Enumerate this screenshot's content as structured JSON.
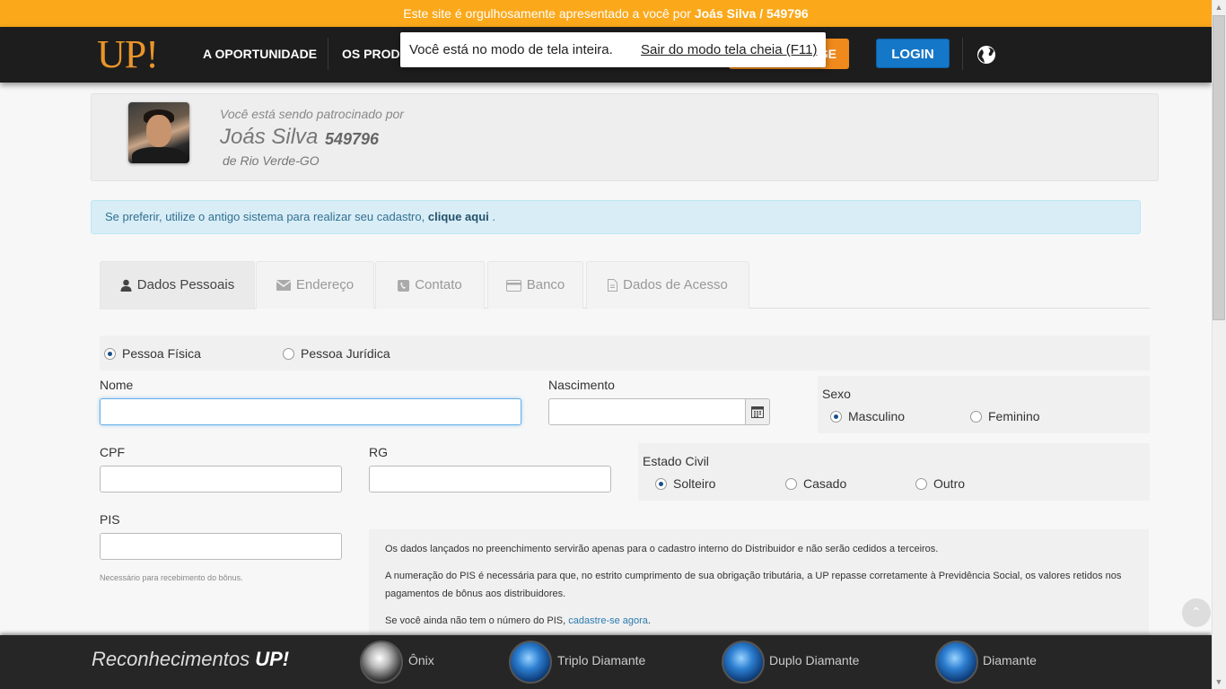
{
  "topbar": {
    "text_prefix": "Este site é orgulhosamente apresentado a você por",
    "sponsor_highlight": "Joás Silva / 549796"
  },
  "nav": {
    "logo": "UP!",
    "items": [
      "A OPORTUNIDADE",
      "OS PRODU"
    ],
    "orange_button": "SE",
    "login": "LOGIN"
  },
  "fullscreen": {
    "message": "Você está no modo de tela inteira.",
    "exit": "Sair do modo tela cheia (F11)"
  },
  "sponsor": {
    "label": "Você está sendo patrocinado por",
    "name": "Joás Silva",
    "id": "549796",
    "city": "de  Rio Verde-GO"
  },
  "alert": {
    "text": "Se preferir, utilize o antigo sistema para realizar seu cadastro,",
    "link": "clique aqui",
    "suffix": "."
  },
  "tabs": [
    {
      "label": "Dados Pessoais",
      "icon": "user-icon"
    },
    {
      "label": "Endereço",
      "icon": "envelope-icon"
    },
    {
      "label": "Contato",
      "icon": "phone-icon"
    },
    {
      "label": "Banco",
      "icon": "credit-card-icon"
    },
    {
      "label": "Dados de Acesso",
      "icon": "file-icon"
    }
  ],
  "person_type": {
    "options": [
      "Pessoa Física",
      "Pessoa Jurídica"
    ],
    "selected": "Pessoa Física"
  },
  "fields": {
    "nome": {
      "label": "Nome",
      "value": ""
    },
    "nascimento": {
      "label": "Nascimento",
      "value": ""
    },
    "sexo": {
      "label": "Sexo",
      "options": [
        "Masculino",
        "Feminino"
      ],
      "selected": "Masculino"
    },
    "cpf": {
      "label": "CPF",
      "value": ""
    },
    "rg": {
      "label": "RG",
      "value": ""
    },
    "estado_civil": {
      "label": "Estado Civil",
      "options": [
        "Solteiro",
        "Casado",
        "Outro"
      ],
      "selected": "Solteiro"
    },
    "pis": {
      "label": "PIS",
      "value": "",
      "help": "Necessário para recebimento do bônus."
    }
  },
  "info": {
    "p1": "Os dados lançados no preenchimento servirão apenas para o cadastro interno do Distribuidor e não serão cedidos a terceiros.",
    "p2": "A numeração do PIS é necessária para que, no estrito cumprimento de sua obrigação tributária, a UP repasse corretamente à Previdência Social, os valores retidos nos pagamentos de bônus aos distribuidores.",
    "p3_prefix": "Se você ainda não tem o número do PIS,",
    "p3_link": "cadastre-se agora",
    "p3_suffix": "."
  },
  "footer": {
    "title_prefix": "Reconhecimentos",
    "title_brand": "UP!",
    "badges": [
      {
        "label": "Ônix",
        "icon": "onix-badge-icon"
      },
      {
        "label": "Triplo Diamante",
        "icon": "triple-diamond-badge-icon"
      },
      {
        "label": "Duplo Diamante",
        "icon": "double-diamond-badge-icon"
      },
      {
        "label": "Diamante",
        "icon": "diamond-badge-icon"
      }
    ]
  },
  "colors": {
    "topbar": "#fba81a",
    "nav": "#1d1d1d",
    "login": "#1577c8",
    "orange": "#f08a1d",
    "alert_bg": "#d9edf7"
  }
}
